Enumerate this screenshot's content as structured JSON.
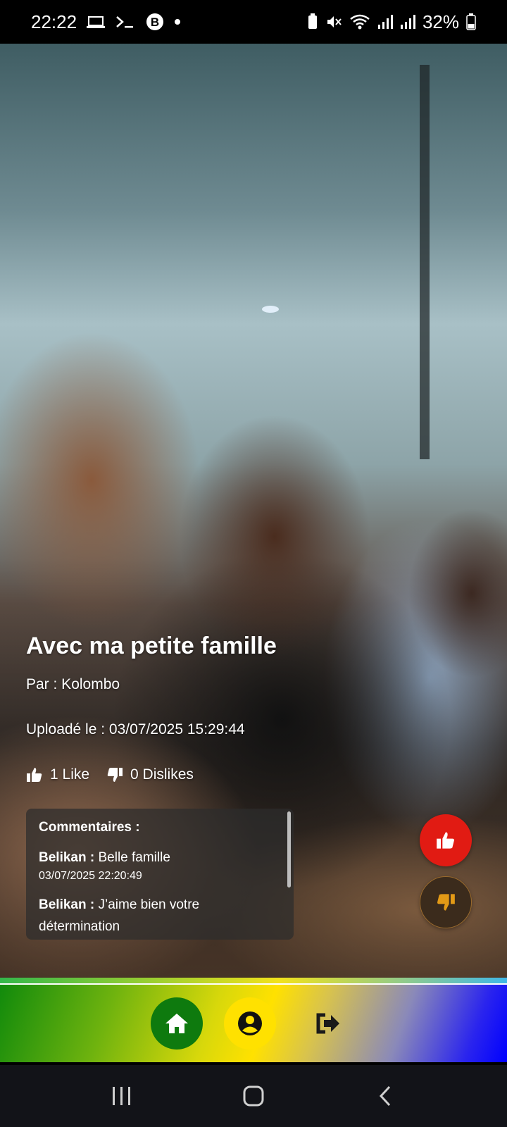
{
  "status_bar": {
    "time": "22:22",
    "battery": "32%"
  },
  "post": {
    "title": "Avec ma petite famille",
    "author": "Par : Kolombo",
    "uploaded": "Uploadé le : 03/07/2025 15:29:44",
    "likes": "1 Like",
    "dislikes": "0 Dislikes"
  },
  "comments": {
    "heading": "Commentaires :",
    "items": [
      {
        "author": "Belikan :",
        "text": "Belle famille",
        "time": "03/07/2025 22:20:49"
      },
      {
        "author": "Belikan :",
        "text": "J’aime bien votre détermination",
        "time": ""
      }
    ]
  },
  "icons": {
    "like_fab": "thumbs-up-icon",
    "dislike_fab": "thumbs-down-icon",
    "home": "home-icon",
    "profile": "user-circle-icon",
    "logout": "logout-icon"
  },
  "colors": {
    "like_fab": "#e11b13",
    "dislike_fab": "#3b2b1c",
    "nav_home": "#0e7a0e",
    "nav_profile": "#ffe100"
  }
}
